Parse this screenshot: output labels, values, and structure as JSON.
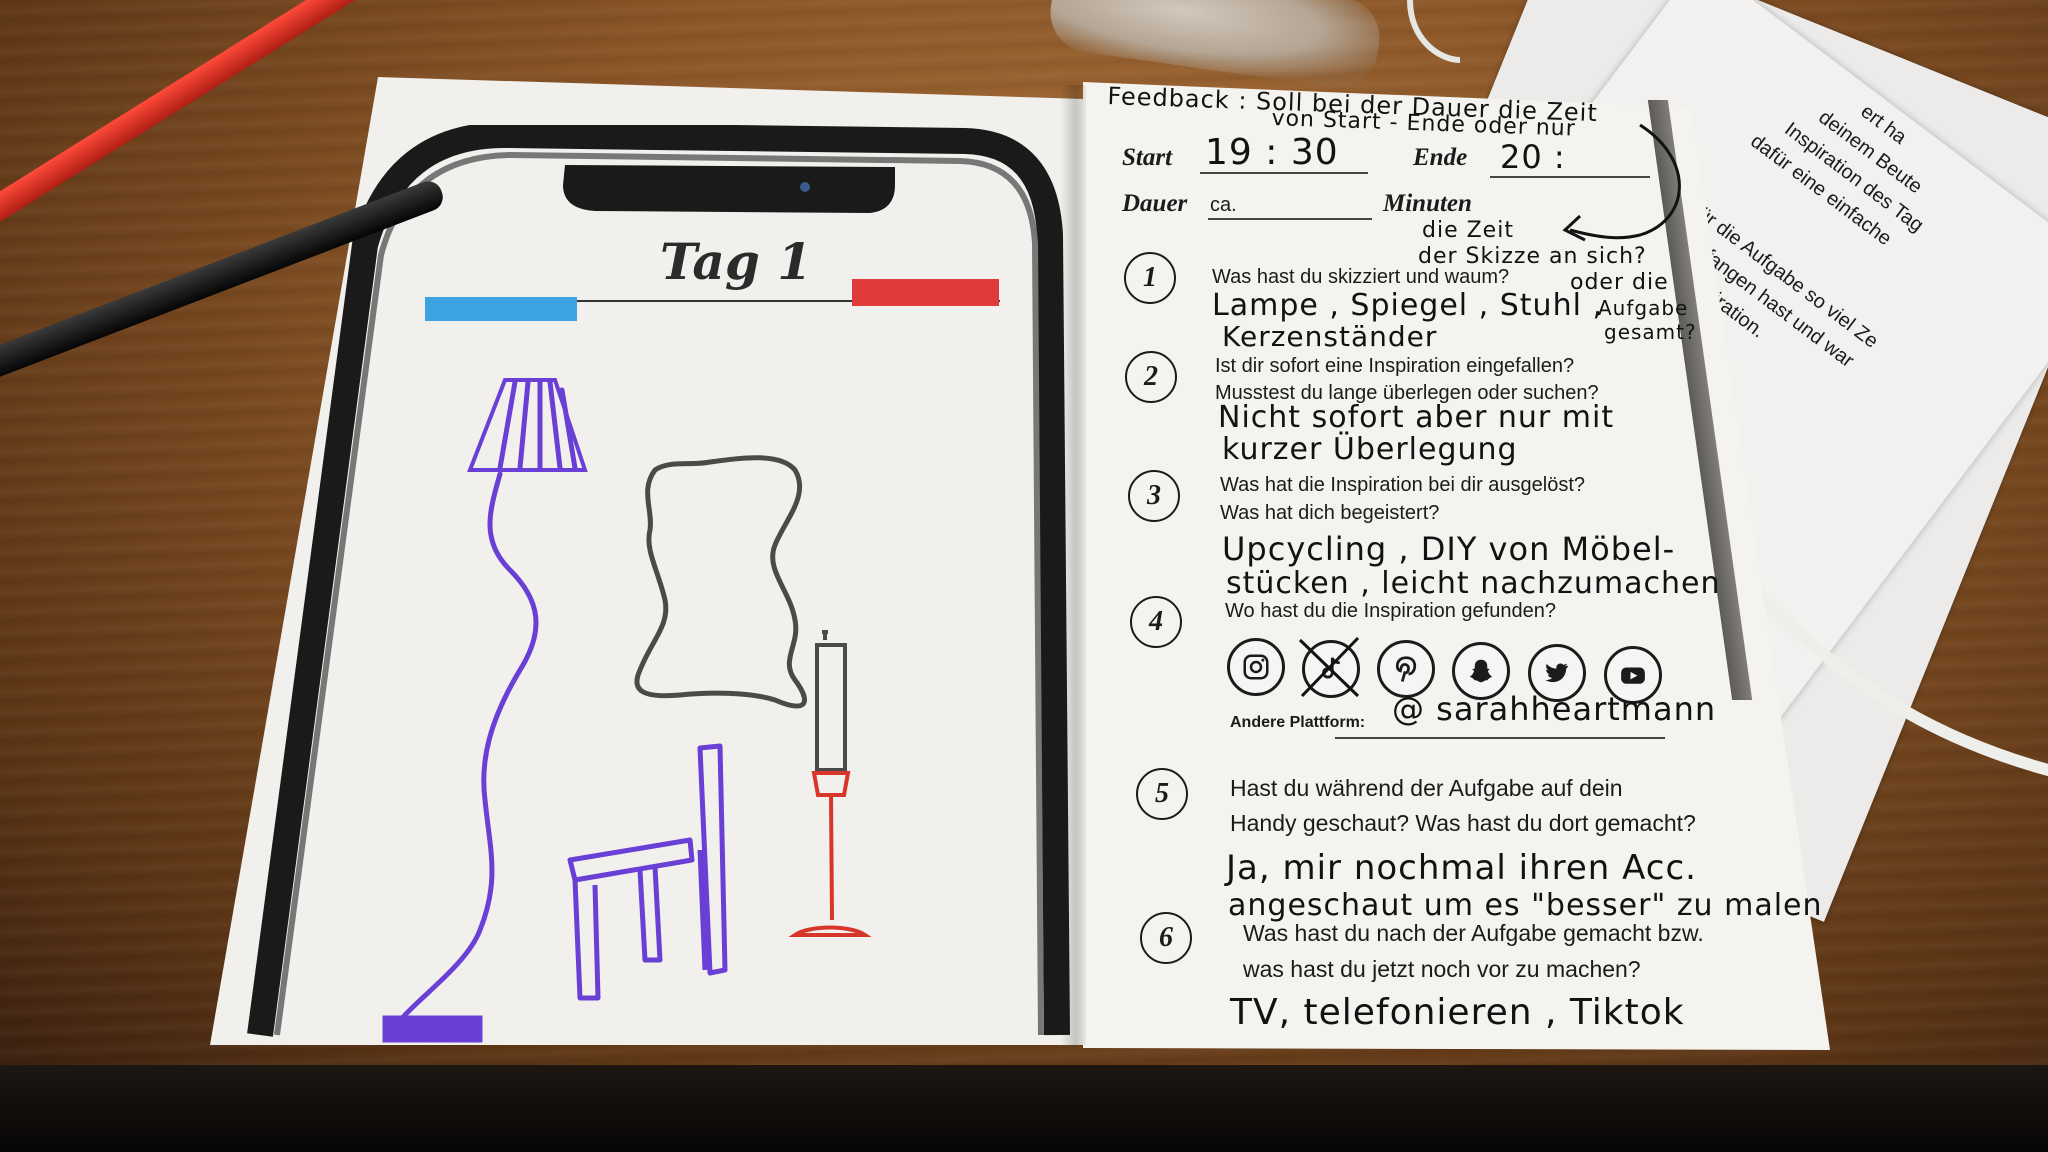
{
  "left_page": {
    "day_title": "Tag 1",
    "icons": [
      "floor-lamp-drawing",
      "mirror-drawing",
      "chair-drawing",
      "candle-holder-drawing"
    ]
  },
  "right_page": {
    "feedback_note": {
      "line1": "Feedback : Soll bei der Dauer die Zeit",
      "line2": "von Start - Ende oder nur",
      "line3": "die Zeit",
      "line4": "der Skizze an sich?",
      "line5": "oder die",
      "line6": "Aufgabe",
      "line7": "gesamt?"
    },
    "start_label": "Start",
    "start_value": "19 : 30",
    "end_label": "Ende",
    "end_value": "20 :",
    "duration_label": "Dauer",
    "duration_prefix": "ca.",
    "duration_unit": "Minuten",
    "questions": [
      {
        "number": "1",
        "text": "Was hast du skizziert und waum?",
        "answer_line1": "Lampe , Spiegel , Stuhl ,",
        "answer_line2": "Kerzenständer"
      },
      {
        "number": "2",
        "text_line1": "Ist dir sofort eine Inspiration eingefallen?",
        "text_line2": "Musstest du lange überlegen oder suchen?",
        "answer_line1": "Nicht sofort aber nur mit",
        "answer_line2": "kurzer Überlegung"
      },
      {
        "number": "3",
        "text_line1": "Was hat die Inspiration bei dir ausgelöst?",
        "text_line2": "Was hat dich begeistert?",
        "answer_line1": "Upcycling , DIY von Möbel-",
        "answer_line2": "stücken , leicht nachzumachen"
      },
      {
        "number": "4",
        "text": "Wo hast du die Inspiration gefunden?",
        "other_label": "Andere Plattform:",
        "other_value": "@ sarahheartmann"
      },
      {
        "number": "5",
        "text_line1": "Hast du während der Aufgabe auf dein",
        "text_line2": "Handy geschaut? Was hast du dort gemacht?",
        "answer_line1": "Ja, mir nochmal ihren Acc.",
        "answer_line2": "angeschaut um es \"besser\" zu malen"
      },
      {
        "number": "6",
        "text_line1": "Was hast du nach der Aufgabe gemacht bzw.",
        "text_line2": "was hast du jetzt noch vor zu machen?",
        "answer_line1": "TV, telefonieren , Tiktok"
      }
    ],
    "platforms": [
      "instagram-icon",
      "tiktok-icon-crossed",
      "pinterest-icon",
      "snapchat-icon",
      "twitter-icon",
      "youtube-icon"
    ]
  },
  "background_sheet": {
    "line1": "ert ha",
    "line2": "deinem Beute",
    "line3": "Inspiration des Tag",
    "line4": "dafür eine einfache",
    "line5": "Nimm dir für die Aufgabe so viel Ze",
    "line6": "Skizzieren angefangen hast und war",
    "line7": "Fragen zu deiner Inspiration."
  },
  "colors": {
    "table": "#7a4a22",
    "paper": "#f4f3f0",
    "blue_bar": "#3aa3e0",
    "red_bar": "#e03a3a",
    "purple": "#6a3fd6",
    "red_pen": "#d8362b",
    "gray_sketch": "#4a4a48"
  }
}
